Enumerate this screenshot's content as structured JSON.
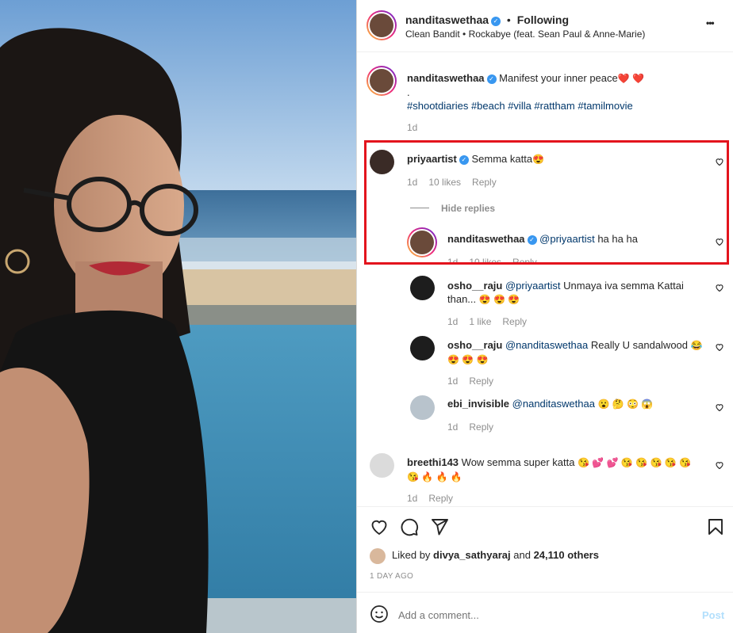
{
  "header": {
    "username": "nanditaswethaa",
    "follow_status": "Following",
    "audio": "Clean Bandit • Rockabye (feat. Sean Paul & Anne-Marie)",
    "more_label": "•••"
  },
  "caption": {
    "username": "nanditaswethaa",
    "text": "Manifest your inner peace",
    "text_emoji": "❤️ ❤️",
    "dot": ".",
    "hashtags": "#shootdiaries #beach #villa #rattham #tamilmovie",
    "time": "1d"
  },
  "comments": [
    {
      "username": "priyaartist",
      "verified": true,
      "mention": "",
      "text": "Semma katta",
      "emoji": "😍",
      "time": "1d",
      "likes": "10 likes",
      "reply": "Reply"
    }
  ],
  "hide_replies": "Hide replies",
  "replies": [
    {
      "username": "nanditaswethaa",
      "mention": "@priyaartist",
      "text": "ha ha ha",
      "time": "1d",
      "likes": "10 likes",
      "reply": "Reply"
    },
    {
      "username": "osho__raju",
      "mention": "@priyaartist",
      "text": "Unmaya iva semma Kattai",
      "text2": "than...",
      "emoji": "😍 😍 😍",
      "time": "1d",
      "likes": "1 like",
      "reply": "Reply"
    },
    {
      "username": "osho__raju",
      "mention": "@nanditaswethaa",
      "text": "Really U sandalwood",
      "emoji": "😂",
      "emoji2": "😍 😍 😍",
      "time": "1d",
      "reply": "Reply"
    },
    {
      "username": "ebi_invisible",
      "mention": "@nanditaswethaa",
      "emoji": "😮 🤔 😳 😱",
      "time": "1d",
      "reply": "Reply"
    }
  ],
  "comment_last": {
    "username": "breethi143",
    "text": "Wow semma super katta",
    "emoji": "😘 💕 💕 😘 😘 😘 😘 😘",
    "emoji2": "😘 🔥 🔥 🔥",
    "time": "1d",
    "reply": "Reply"
  },
  "likes_line": {
    "prefix": "Liked by",
    "user": "divya_sathyaraj",
    "middle": "and",
    "count": "24,110 others"
  },
  "date": "1 DAY AGO",
  "composer": {
    "placeholder": "Add a comment...",
    "post_label": "Post"
  },
  "icons": {
    "like": "heart-outline-icon",
    "comment": "comment-bubble-icon",
    "share": "paper-plane-icon",
    "save": "bookmark-icon",
    "emoji": "smiley-icon"
  },
  "colors": {
    "highlight_box": "#e3141d",
    "verified": "#3897f0",
    "link": "#00376b",
    "post_button": "#b2dffc"
  }
}
